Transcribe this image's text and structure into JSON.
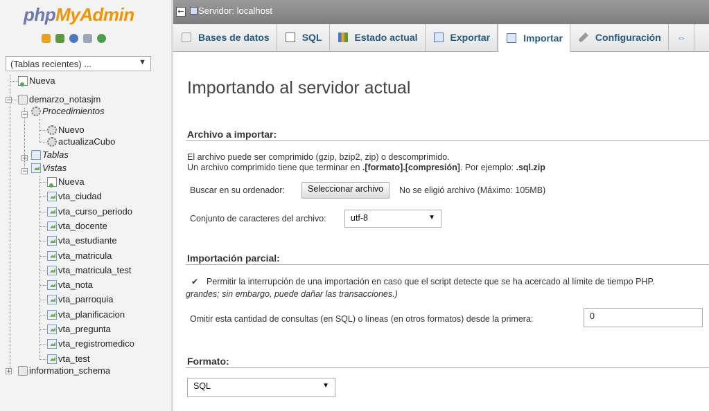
{
  "logo": {
    "php": "php",
    "myadmin": "MyAdmin"
  },
  "quick_icons": [
    {
      "name": "home-icon",
      "color": "#e8a21b"
    },
    {
      "name": "logout-icon",
      "color": "#5a9a3d"
    },
    {
      "name": "query-icon",
      "color": "#4a78c2"
    },
    {
      "name": "docs-icon",
      "color": "#9aa7b7"
    },
    {
      "name": "reload-icon",
      "color": "#4aa04a"
    }
  ],
  "sidebar": {
    "recent_select": "(Tablas recientes) ...",
    "tree": {
      "nueva_root": "Nueva",
      "db1": "demarzo_notasjm",
      "procedimientos": "Procedimientos",
      "proc_items": [
        "Nuevo",
        "actualizaCubo"
      ],
      "tablas": "Tablas",
      "vistas": "Vistas",
      "vistas_items": [
        "Nueva",
        "vta_ciudad",
        "vta_curso_periodo",
        "vta_docente",
        "vta_estudiante",
        "vta_matricula",
        "vta_matricula_test",
        "vta_nota",
        "vta_parroquia",
        "vta_planificacion",
        "vta_pregunta",
        "vta_registromedico",
        "vta_test"
      ],
      "db2": "information_schema"
    }
  },
  "serverbar": {
    "collapse": "←",
    "label": "Servidor: localhost"
  },
  "tabs": [
    {
      "label": "Bases de datos",
      "icon": "database-icon"
    },
    {
      "label": "SQL",
      "icon": "sql-icon"
    },
    {
      "label": "Estado actual",
      "icon": "status-icon"
    },
    {
      "label": "Exportar",
      "icon": "export-icon"
    },
    {
      "label": "Importar",
      "icon": "import-icon",
      "active": true
    },
    {
      "label": "Configuración",
      "icon": "wrench-icon"
    },
    {
      "label": "",
      "icon": "more-icon"
    }
  ],
  "main": {
    "title": "Importando al servidor actual",
    "archivo": {
      "heading": "Archivo a importar:",
      "line1": "El archivo puede ser comprimido (gzip, bzip2, zip) o descomprimido.",
      "line2_a": "Un archivo comprimido tiene que terminar en ",
      "line2_b": ".[formato].[compresión]",
      "line2_c": ". Por ejemplo: ",
      "line2_d": ".sql.zip",
      "browse_label": "Buscar en su ordenador:",
      "browse_button": "Seleccionar archivo",
      "browse_status": "No se eligió archivo (Máximo: 105MB)",
      "charset_label": "Conjunto de caracteres del archivo:",
      "charset_value": "utf-8"
    },
    "parcial": {
      "heading": "Importación parcial:",
      "allow_interrupt": "Permitir la interrupción de una importación en caso que el script detecte que se ha acercado al límite de tiempo PHP.",
      "allow_interrupt_note": "grandes; sin embargo, puede dañar las transacciones.)",
      "skip_label": "Omitir esta cantidad de consultas (en SQL) o líneas (en otros formatos) desde la primera:",
      "skip_value": "0"
    },
    "formato": {
      "heading": "Formato:",
      "value": "SQL"
    }
  }
}
